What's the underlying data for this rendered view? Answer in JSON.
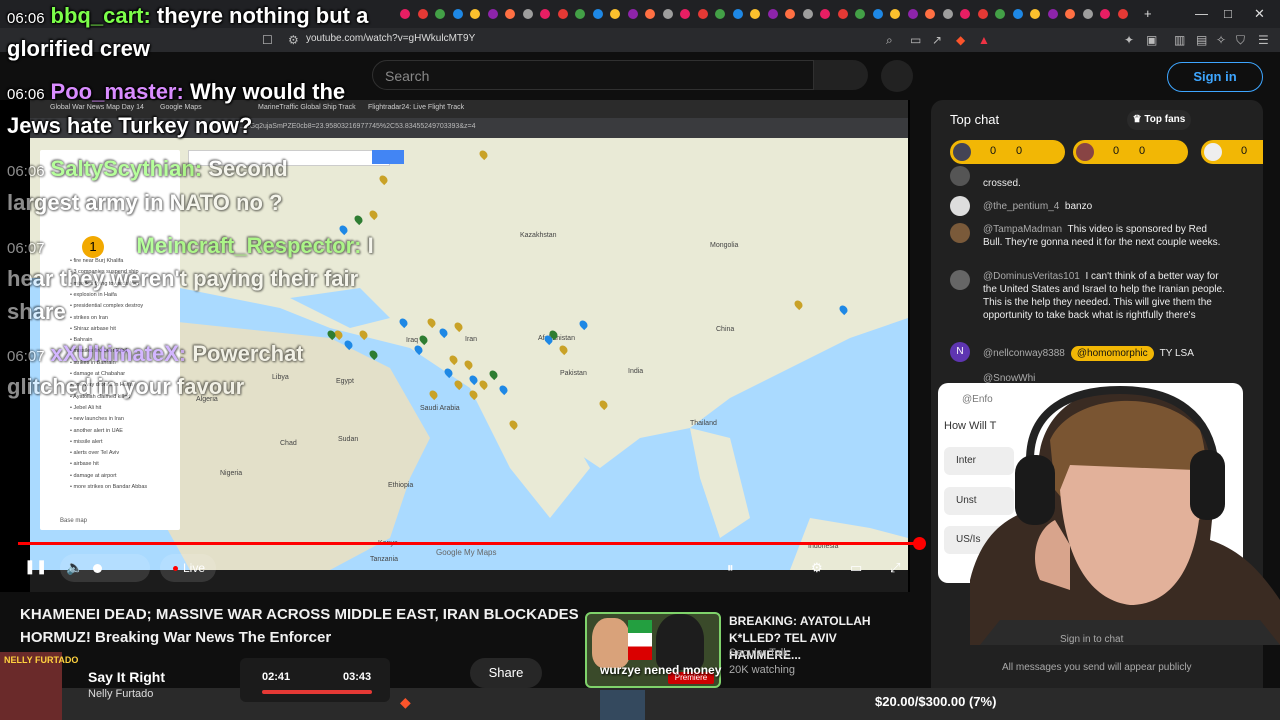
{
  "browser": {
    "url": "youtube.com/watch?v=gHWkulcMT9Y",
    "window_controls": [
      "—",
      "□",
      "✕"
    ],
    "new_tab": "+"
  },
  "youtube": {
    "search_placeholder": "Search",
    "signin_label": "Sign in"
  },
  "overlay_chat": [
    {
      "time": "06:06",
      "user": "bbq_cart",
      "color": "#7cff4a",
      "text": "theyre nothing but a",
      "cont": "glorified crew"
    },
    {
      "time": "06:06",
      "user": "Poo_master",
      "color": "#d98cff",
      "text": "Why would the",
      "cont": "Jews hate Turkey now?"
    },
    {
      "time": "06:06",
      "user": "SaltyScythian",
      "color": "#7cff4a",
      "text": "Second",
      "cont": "largest army in NATO no ?"
    },
    {
      "time": "06:07",
      "user": "Meincraft_Respector",
      "color": "#7cff4a",
      "text": "I",
      "cont": "hear they weren't paying their fair",
      "cont2": "share",
      "badge": "1"
    },
    {
      "time": "06:07",
      "user": "xXUltimateX",
      "color": "#b07cff",
      "text": "Powerchat",
      "cont": "glitched in your favour"
    }
  ],
  "player": {
    "inner_tabs": [
      "Global War News Map Day 14",
      "Google Maps",
      "MarineTraffic Global Ship Track",
      "Flightradar24: Live Flight Track"
    ],
    "inner_url": "...1Gq2ujaSmPZE0cb8=23.95803216977745%2C53.83455249703393&z=4",
    "map_search_placeholder": "",
    "layers": [
      "fire near Burj Khalifa",
      "3 companies suspend ship",
      "missiles flying towards Iran",
      "explosion in Haifa",
      "presidential complex destroy",
      "strikes on Iran",
      "Shiraz airbase hit",
      "Bahrain",
      "missiles fire over Erbil",
      "strikes in Bahrain",
      "damage at Chabahar",
      "one-way drones in Haifa",
      "Ayatollah claimed killed",
      "Jebel Ali hit",
      "new launches in Iran",
      "another alert in UAE",
      "missile alert",
      "alerts over Tel Aviv",
      "airbase hit",
      "damage at airport",
      "more strikes on Bandar Abbas"
    ],
    "basemap_label": "Base map",
    "countries": [
      {
        "name": "Kazakhstan"
      },
      {
        "name": "Mongolia"
      },
      {
        "name": "China"
      },
      {
        "name": "Iraq"
      },
      {
        "name": "Iran"
      },
      {
        "name": "Afghanistan"
      },
      {
        "name": "Pakistan"
      },
      {
        "name": "India"
      },
      {
        "name": "Libya"
      },
      {
        "name": "Egypt"
      },
      {
        "name": "Chad"
      },
      {
        "name": "Sudan"
      },
      {
        "name": "Ethiopia"
      },
      {
        "name": "Kenya"
      },
      {
        "name": "Tanzania"
      },
      {
        "name": "Algeria"
      },
      {
        "name": "Nigeria"
      },
      {
        "name": "Saudi Arabia"
      },
      {
        "name": "Thailand"
      },
      {
        "name": "Indonesia"
      }
    ],
    "map_credit": "Google My Maps",
    "live_label": "Live",
    "progress_fraction": 1.0
  },
  "video": {
    "title": "KHAMENEI DEAD; MASSIVE WAR ACROSS MIDDLE EAST, IRAN BLOCKADES HORMUZ! Breaking War News The Enforcer",
    "share_label": "Share"
  },
  "recommended": {
    "title": "BREAKING: AYATOLLAH K*LLED? TEL AVIV HAMMERE...",
    "channel": "Secular Talk",
    "views": "20K watching",
    "badge": "Premiere",
    "caption": "wurzye nened money"
  },
  "chat": {
    "title": "Top chat",
    "top_fans_label": "Top fans",
    "fans": [
      {
        "a": "0",
        "b": "0"
      },
      {
        "a": "0",
        "b": "0"
      },
      {
        "a": "0",
        "b": ""
      }
    ],
    "messages": [
      {
        "user": "",
        "text": "crossed."
      },
      {
        "user": "@the_pentium_4",
        "text": "banzo"
      },
      {
        "user": "@TampaMadman",
        "text": "This video is sponsored by Red Bull. They're gonna need it for the next couple weeks."
      },
      {
        "user": "@DominusVeritas101",
        "text": "I can't think of a better way for the United States and Israel to help the Iranian people. This is the help they needed. This will give them the opportunity to take back what is rightfully there's"
      },
      {
        "user": "@nellconway8388",
        "badge": "@homomorphic",
        "text": "TY LSA"
      },
      {
        "user": "@SnowWhi",
        "text": ""
      }
    ],
    "poll": {
      "user": "@Enfo",
      "question": "How Will T",
      "options": [
        "Inter",
        "Unst",
        "US/Is"
      ]
    },
    "signin_prompt": "Sign in to chat",
    "footer": "All messages you send will appear publicly"
  },
  "music": {
    "album_label": "NELLY FURTADO",
    "song": "Say It Right",
    "artist": "Nelly Furtado",
    "time_current": "02:41",
    "time_total": "03:43"
  },
  "donation": "$20.00/$300.00 (7%)",
  "colors": {
    "accent": "#ff0000",
    "gold": "#f2b705",
    "link": "#3ea6ff"
  }
}
